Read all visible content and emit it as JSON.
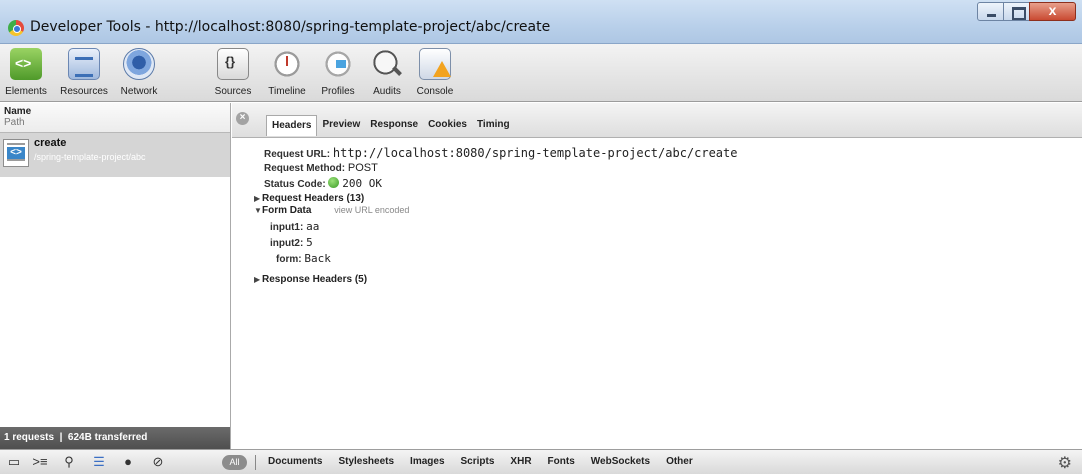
{
  "window": {
    "title": "Developer Tools - http://localhost:8080/spring-template-project/abc/create",
    "minimize_label": "",
    "maximize_label": "",
    "close_label": "x"
  },
  "toolbar": {
    "items": [
      {
        "label": "Elements",
        "icon": "elements-icon"
      },
      {
        "label": "Resources",
        "icon": "resources-icon"
      },
      {
        "label": "Network",
        "icon": "network-icon",
        "active": true
      },
      {
        "label": "Sources",
        "icon": "sources-icon"
      },
      {
        "label": "Timeline",
        "icon": "timeline-icon"
      },
      {
        "label": "Profiles",
        "icon": "profiles-icon"
      },
      {
        "label": "Audits",
        "icon": "audits-icon"
      },
      {
        "label": "Console",
        "icon": "console-icon"
      }
    ]
  },
  "requests_panel": {
    "col_name": "Name",
    "col_path": "Path",
    "requests": [
      {
        "name": "create",
        "path": "/spring-template-project/abc"
      }
    ],
    "footer": "1 requests  |  624B transferred"
  },
  "detail_tabs": [
    "Headers",
    "Preview",
    "Response",
    "Cookies",
    "Timing"
  ],
  "headers": {
    "request_url_label": "Request URL:",
    "request_url": "http://localhost:8080/spring-template-project/abc/create",
    "request_method_label": "Request Method:",
    "request_method": "POST",
    "status_code_label": "Status Code:",
    "status_code": "200 OK",
    "status_color": "#3a9a25",
    "request_headers": "Request Headers (13)",
    "form_data": "Form Data",
    "form_data_note": "view URL encoded",
    "form_fields": [
      {
        "key": "input1:",
        "value": "aa"
      },
      {
        "key": "input2:",
        "value": "5"
      },
      {
        "key": "form:",
        "value": "Back"
      }
    ],
    "response_headers": "Response Headers (5)"
  },
  "statusbar": {
    "all_label": "All",
    "filters": [
      "Documents",
      "Stylesheets",
      "Images",
      "Scripts",
      "XHR",
      "Fonts",
      "WebSockets",
      "Other"
    ],
    "icons": [
      "dock-icon",
      "console-prompt-icon",
      "search-icon",
      "list-icon",
      "record-icon",
      "clear-icon",
      "gear-icon"
    ]
  }
}
